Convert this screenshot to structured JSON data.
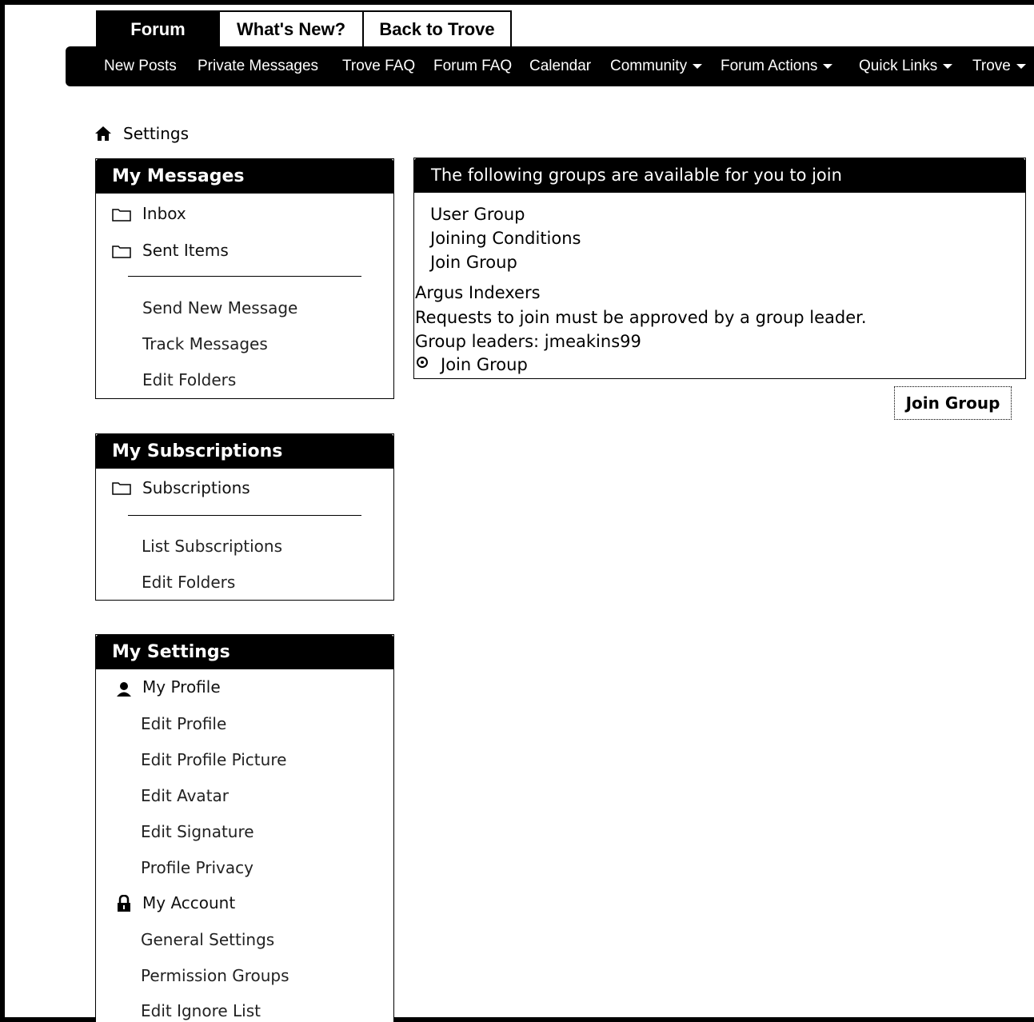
{
  "tabs": [
    "Forum",
    "What's New?",
    "Back to Trove"
  ],
  "navbar": {
    "items": [
      "New Posts",
      "Private Messages",
      "Trove FAQ",
      "Forum FAQ",
      "Calendar"
    ],
    "dropdowns": [
      "Community",
      "Forum Actions",
      "Quick Links",
      "Trove"
    ]
  },
  "breadcrumb": {
    "icon": "home-icon",
    "label": "Settings"
  },
  "my_messages": {
    "title": "My Messages",
    "folders": [
      "Inbox",
      "Sent Items"
    ],
    "links": [
      "Send New Message",
      "Track Messages",
      "Edit Folders"
    ]
  },
  "my_subscriptions": {
    "title": "My Subscriptions",
    "folders": [
      "Subscriptions"
    ],
    "links": [
      "List Subscriptions",
      "Edit Folders"
    ]
  },
  "my_settings": {
    "title": "My Settings",
    "profile_label": "My Profile",
    "profile_links": [
      "Edit Profile",
      "Edit Profile Picture",
      "Edit Avatar",
      "Edit Signature",
      "Profile Privacy"
    ],
    "account_label": "My Account",
    "account_links": [
      "General Settings",
      "Permission Groups",
      "Edit Ignore List"
    ]
  },
  "groups": {
    "header": "The following groups are available for you to join",
    "columns": [
      "User Group",
      "Joining Conditions",
      "Join Group"
    ],
    "group_name": "Argus Indexers",
    "condition": "Requests to join must be approved by a group leader.",
    "leaders": "Group leaders: jmeakins99",
    "radio_label": "Join Group",
    "radio_selected": true,
    "submit_label": "Join Group"
  }
}
